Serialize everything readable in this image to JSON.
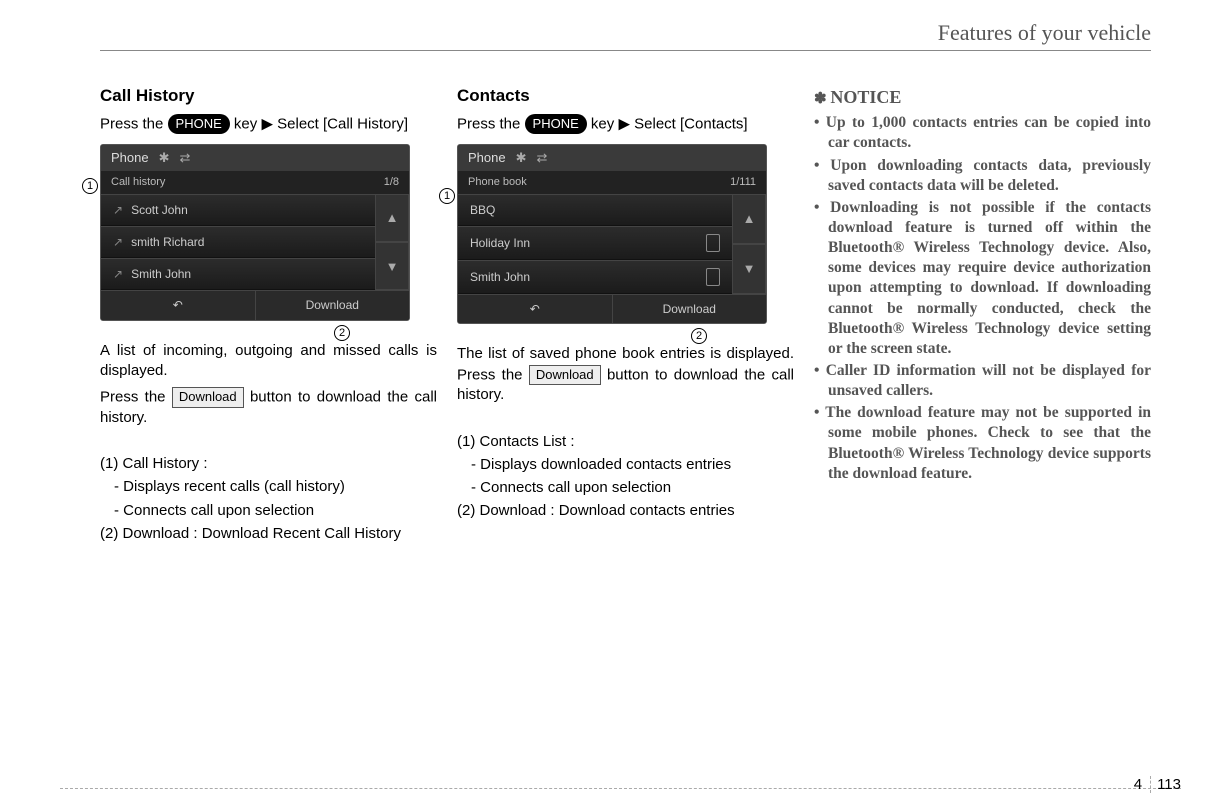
{
  "header": {
    "section_title": "Features of your vehicle"
  },
  "col1": {
    "heading": "Call History",
    "intro_pre": "Press the ",
    "phone_key": "PHONE",
    "intro_post": " key ▶ Select [Call History]",
    "screen": {
      "title": "Phone",
      "subtitle": "Call history",
      "page": "1/8",
      "rows": [
        "Scott John",
        "smith Richard",
        "Smith John"
      ],
      "back": "↶",
      "download": "Download"
    },
    "para1": "A list of incoming, outgoing and missed calls is displayed.",
    "para2_pre": "Press the ",
    "download_label": "Download",
    "para2_post": " button to download the call history.",
    "item1_head": "(1) Call History :",
    "item1_a": "- Displays recent calls (call history)",
    "item1_b": "- Connects call upon selection",
    "item2": "(2) Download : Download Recent Call History"
  },
  "col2": {
    "heading": "Contacts",
    "intro_pre": "Press the ",
    "phone_key": "PHONE",
    "intro_post": " key ▶ Select [Contacts]",
    "screen": {
      "title": "Phone",
      "subtitle": "Phone book",
      "page": "1/111",
      "rows": [
        "BBQ",
        "Holiday Inn",
        "Smith John"
      ],
      "back": "↶",
      "download": "Download"
    },
    "para1_pre": "The list of saved phone book entries is displayed. Press the ",
    "download_label": "Download",
    "para1_post": " button to download the call history.",
    "item1_head": "(1) Contacts List :",
    "item1_a": "- Displays downloaded contacts entries",
    "item1_b": "- Connects call upon selection",
    "item2": "(2) Download : Download contacts entries"
  },
  "col3": {
    "notice_label": "NOTICE",
    "bullets": [
      "Up to 1,000 contacts entries can be copied into car contacts.",
      "Upon downloading contacts data, previously saved contacts data will be deleted.",
      "Downloading is not possible if the contacts download feature is turned off within the Bluetooth® Wireless Technology device. Also, some devices may require device authorization upon attempting to download. If downloading cannot be normally conducted, check the Bluetooth® Wireless Technology device setting or the screen state.",
      "Caller ID information will not be displayed for unsaved callers.",
      "The download feature may not be supported in some mobile phones. Check to see that the Bluetooth® Wireless Technology device supports the download feature."
    ]
  },
  "footer": {
    "chapter": "4",
    "page": "113"
  }
}
